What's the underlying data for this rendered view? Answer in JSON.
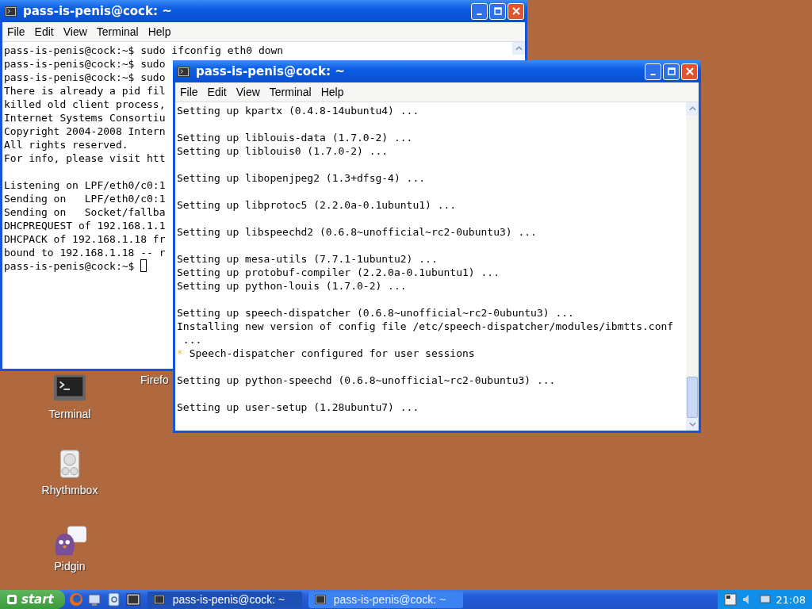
{
  "desktop": {
    "icons": [
      {
        "kind": "firefox",
        "label": "Firefo"
      },
      {
        "kind": "terminal",
        "label": "Terminal"
      },
      {
        "kind": "rhythmbox",
        "label": "Rhythmbox"
      },
      {
        "kind": "pidgin",
        "label": "Pidgin"
      }
    ]
  },
  "windows": [
    {
      "title": "pass-is-penis@cock: ~",
      "menu": [
        "File",
        "Edit",
        "View",
        "Terminal",
        "Help"
      ],
      "cursor": true,
      "blocks": [
        [
          "pass-is-penis@cock:~$ sudo ifconfig eth0 down",
          "pass-is-penis@cock:~$ sudo",
          "pass-is-penis@cock:~$ sudo",
          "There is already a pid fil",
          "killed old client process,",
          "Internet Systems Consortiu",
          "Copyright 2004-2008 Intern",
          "All rights reserved.",
          "For info, please visit htt"
        ],
        [
          "Listening on LPF/eth0/c0:1",
          "Sending on   LPF/eth0/c0:1",
          "Sending on   Socket/fallba",
          "DHCPREQUEST of 192.168.1.1",
          "DHCPACK of 192.168.1.18 fr",
          "bound to 192.168.1.18 -- r",
          "pass-is-penis@cock:~$ "
        ]
      ]
    },
    {
      "title": "pass-is-penis@cock: ~",
      "menu": [
        "File",
        "Edit",
        "View",
        "Terminal",
        "Help"
      ],
      "blocks": [
        [
          "Setting up kpartx (0.4.8-14ubuntu4) ..."
        ],
        [
          "Setting up liblouis-data (1.7.0-2) ...",
          "Setting up liblouis0 (1.7.0-2) ..."
        ],
        [
          "Setting up libopenjpeg2 (1.3+dfsg-4) ..."
        ],
        [
          "Setting up libprotoc5 (2.2.0a-0.1ubuntu1) ..."
        ],
        [
          "Setting up libspeechd2 (0.6.8~unofficial~rc2-0ubuntu3) ..."
        ],
        [
          "Setting up mesa-utils (7.7.1-1ubuntu2) ...",
          "Setting up protobuf-compiler (2.2.0a-0.1ubuntu1) ...",
          "Setting up python-louis (1.7.0-2) ..."
        ],
        [
          "Setting up speech-dispatcher (0.6.8~unofficial~rc2-0ubuntu3) ...",
          "Installing new version of config file /etc/speech-dispatcher/modules/ibmtts.conf",
          " ...",
          {
            "bullet": "*",
            "text": "Speech-dispatcher configured for user sessions"
          }
        ],
        [
          "Setting up python-speechd (0.6.8~unofficial~rc2-0ubuntu3) ..."
        ],
        [
          "Setting up user-setup (1.28ubuntu7) ..."
        ]
      ]
    }
  ],
  "taskbar": {
    "start": "start",
    "tasks": [
      {
        "label": "pass-is-penis@cock: ~",
        "selected": false
      },
      {
        "label": "pass-is-penis@cock: ~",
        "selected": true
      }
    ],
    "clock": "21:08"
  }
}
